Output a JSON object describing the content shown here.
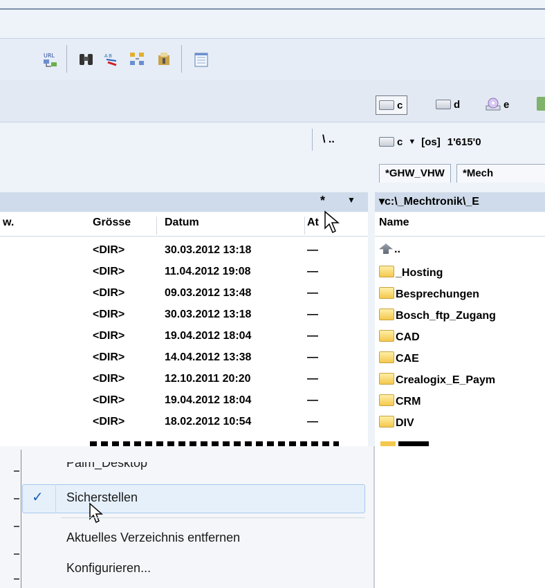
{
  "drives": {
    "c": "c",
    "d": "d",
    "e": "e"
  },
  "path_label": "\\ ..",
  "right_drive_select": {
    "drive": "c",
    "label": "[os]",
    "free": "1'615'0"
  },
  "tabs": [
    "*GHW_VHW",
    "*Mech"
  ],
  "left_panel": {
    "filter_label": "*",
    "columns": [
      "w.",
      "Grösse",
      "Datum",
      "At"
    ],
    "rows": [
      {
        "size": "<DIR>",
        "date": "30.03.2012 13:18",
        "attr": "—"
      },
      {
        "size": "<DIR>",
        "date": "11.04.2012 19:08",
        "attr": "—"
      },
      {
        "size": "<DIR>",
        "date": "09.03.2012 13:48",
        "attr": "—"
      },
      {
        "size": "<DIR>",
        "date": "30.03.2012 13:18",
        "attr": "—"
      },
      {
        "size": "<DIR>",
        "date": "19.04.2012 18:04",
        "attr": "—"
      },
      {
        "size": "<DIR>",
        "date": "14.04.2012 13:38",
        "attr": "—"
      },
      {
        "size": "<DIR>",
        "date": "12.10.2011 20:20",
        "attr": "—"
      },
      {
        "size": "<DIR>",
        "date": "19.04.2012 18:04",
        "attr": "—"
      },
      {
        "size": "<DIR>",
        "date": "18.02.2012 10:54",
        "attr": "—"
      }
    ]
  },
  "right_panel": {
    "path": "▾c:\\_Mechtronik\\_E",
    "column_name": "Name",
    "parent": "..",
    "items": [
      "_Hosting",
      "Besprechungen",
      "Bosch_ftp_Zugang",
      "CAD",
      "CAE",
      "Crealogix_E_Paym",
      "CRM",
      "DIV"
    ]
  },
  "context_menu": {
    "items": [
      {
        "label": "Palm_Desktop",
        "checked": false
      },
      {
        "label": "Sicherstellen",
        "checked": true
      },
      {
        "label": "Aktuelles Verzeichnis entfernen",
        "checked": false
      },
      {
        "label": "Konfigurieren...",
        "checked": false
      }
    ],
    "check_glyph": "✓"
  },
  "colors": {
    "accent": "#1a5fb4",
    "header_bg": "#cfdbea",
    "highlight": "#e6f0fb"
  }
}
